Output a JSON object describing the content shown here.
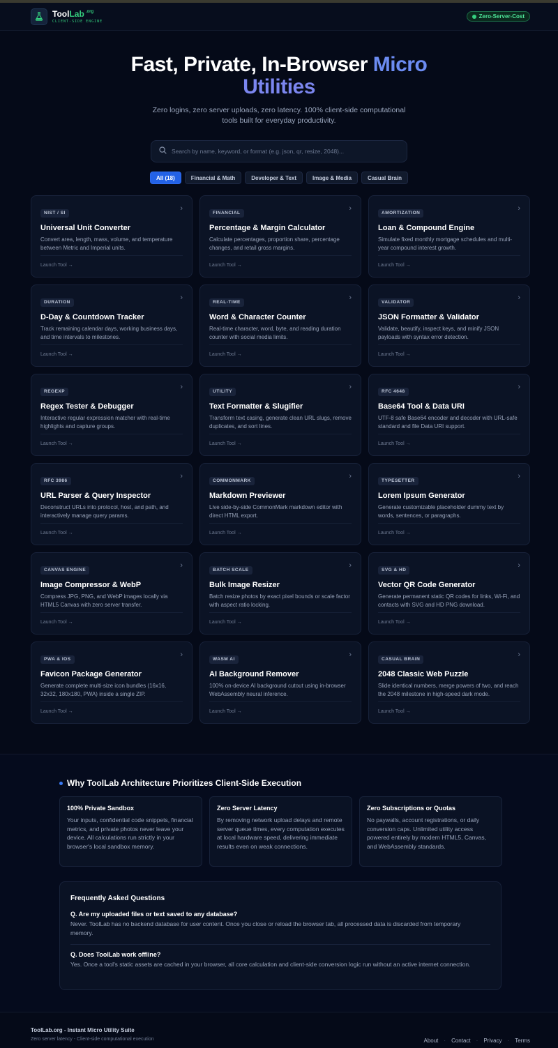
{
  "header": {
    "brand_name_a": "Tool",
    "brand_name_b": "Lab",
    "brand_tld": ".org",
    "brand_sub": "CLIENT-SIDE ENGINE",
    "badge": "Zero-Server-Cost"
  },
  "hero": {
    "title_a": "Fast, Private, In-Browser ",
    "title_b": "Micro",
    "title_c": "Utilities",
    "subtitle": "Zero logins, zero server uploads, zero latency. 100% client-side computational tools built for everyday productivity.",
    "search_placeholder": "Search by name, keyword, or format (e.g. json, qr, resize, 2048)..."
  },
  "filters": [
    "All (18)",
    "Financial & Math",
    "Developer & Text",
    "Image & Media",
    "Casual Brain"
  ],
  "tools": [
    {
      "tag": "NIST / SI",
      "title": "Universal Unit Converter",
      "desc": "Convert area, length, mass, volume, and temperature between Metric and Imperial units.",
      "launch": "Launch Tool →"
    },
    {
      "tag": "FINANCIAL",
      "title": "Percentage & Margin Calculator",
      "desc": "Calculate percentages, proportion share, percentage changes, and retail gross margins.",
      "launch": "Launch Tool →"
    },
    {
      "tag": "AMORTIZATION",
      "title": "Loan & Compound Engine",
      "desc": "Simulate fixed monthly mortgage schedules and multi-year compound interest growth.",
      "launch": "Launch Tool →"
    },
    {
      "tag": "DURATION",
      "title": "D-Day & Countdown Tracker",
      "desc": "Track remaining calendar days, working business days, and time intervals to milestones.",
      "launch": "Launch Tool →"
    },
    {
      "tag": "REAL-TIME",
      "title": "Word & Character Counter",
      "desc": "Real-time character, word, byte, and reading duration counter with social media limits.",
      "launch": "Launch Tool →"
    },
    {
      "tag": "VALIDATOR",
      "title": "JSON Formatter & Validator",
      "desc": "Validate, beautify, inspect keys, and minify JSON payloads with syntax error detection.",
      "launch": "Launch Tool →"
    },
    {
      "tag": "REGEXP",
      "title": "Regex Tester & Debugger",
      "desc": "Interactive regular expression matcher with real-time highlights and capture groups.",
      "launch": "Launch Tool →"
    },
    {
      "tag": "UTILITY",
      "title": "Text Formatter & Slugifier",
      "desc": "Transform text casing, generate clean URL slugs, remove duplicates, and sort lines.",
      "launch": "Launch Tool →"
    },
    {
      "tag": "RFC 4648",
      "title": "Base64 Tool & Data URI",
      "desc": "UTF-8 safe Base64 encoder and decoder with URL-safe standard and file Data URI support.",
      "launch": "Launch Tool →"
    },
    {
      "tag": "RFC 3986",
      "title": "URL Parser & Query Inspector",
      "desc": "Deconstruct URLs into protocol, host, and path, and interactively manage query params.",
      "launch": "Launch Tool →"
    },
    {
      "tag": "COMMONMARK",
      "title": "Markdown Previewer",
      "desc": "Live side-by-side CommonMark markdown editor with direct HTML export.",
      "launch": "Launch Tool →"
    },
    {
      "tag": "TYPESETTER",
      "title": "Lorem Ipsum Generator",
      "desc": "Generate customizable placeholder dummy text by words, sentences, or paragraphs.",
      "launch": "Launch Tool →"
    },
    {
      "tag": "CANVAS ENGINE",
      "title": "Image Compressor & WebP",
      "desc": "Compress JPG, PNG, and WebP images locally via HTML5 Canvas with zero server transfer.",
      "launch": "Launch Tool →"
    },
    {
      "tag": "BATCH SCALE",
      "title": "Bulk Image Resizer",
      "desc": "Batch resize photos by exact pixel bounds or scale factor with aspect ratio locking.",
      "launch": "Launch Tool →"
    },
    {
      "tag": "SVG & HD",
      "title": "Vector QR Code Generator",
      "desc": "Generate permanent static QR codes for links, Wi-Fi, and contacts with SVG and HD PNG download.",
      "launch": "Launch Tool →"
    },
    {
      "tag": "PWA & IOS",
      "title": "Favicon Package Generator",
      "desc": "Generate complete multi-size icon bundles (16x16, 32x32, 180x180, PWA) inside a single ZIP.",
      "launch": "Launch Tool →"
    },
    {
      "tag": "WASM AI",
      "title": "AI Background Remover",
      "desc": "100% on-device AI background cutout using in-browser WebAssembly neural inference.",
      "launch": "Launch Tool →"
    },
    {
      "tag": "CASUAL BRAIN",
      "title": "2048 Classic Web Puzzle",
      "desc": "Slide identical numbers, merge powers of two, and reach the 2048 milestone in high-speed dark mode.",
      "launch": "Launch Tool →"
    }
  ],
  "why": {
    "title": "Why ToolLab Architecture Prioritizes Client-Side Execution",
    "cards": [
      {
        "title": "100% Private Sandbox",
        "text": "Your inputs, confidential code snippets, financial metrics, and private photos never leave your device. All calculations run strictly in your browser's local sandbox memory."
      },
      {
        "title": "Zero Server Latency",
        "text": "By removing network upload delays and remote server queue times, every computation executes at local hardware speed, delivering immediate results even on weak connections."
      },
      {
        "title": "Zero Subscriptions or Quotas",
        "text": "No paywalls, account registrations, or daily conversion caps. Unlimited utility access powered entirely by modern HTML5, Canvas, and WebAssembly standards."
      }
    ]
  },
  "faq": {
    "title": "Frequently Asked Questions",
    "items": [
      {
        "q": "Q. Are my uploaded files or text saved to any database?",
        "a": "Never. ToolLab has no backend database for user content. Once you close or reload the browser tab, all processed data is discarded from temporary memory."
      },
      {
        "q": "Q. Does ToolLab work offline?",
        "a": "Yes. Once a tool's static assets are cached in your browser, all core calculation and client-side conversion logic run without an active internet connection."
      }
    ]
  },
  "footer": {
    "title": "ToolLab.org - Instant Micro Utility Suite",
    "sub": "Zero server latency - Client-side computational execution",
    "links": [
      "About",
      "Contact",
      "Privacy",
      "Terms"
    ]
  }
}
